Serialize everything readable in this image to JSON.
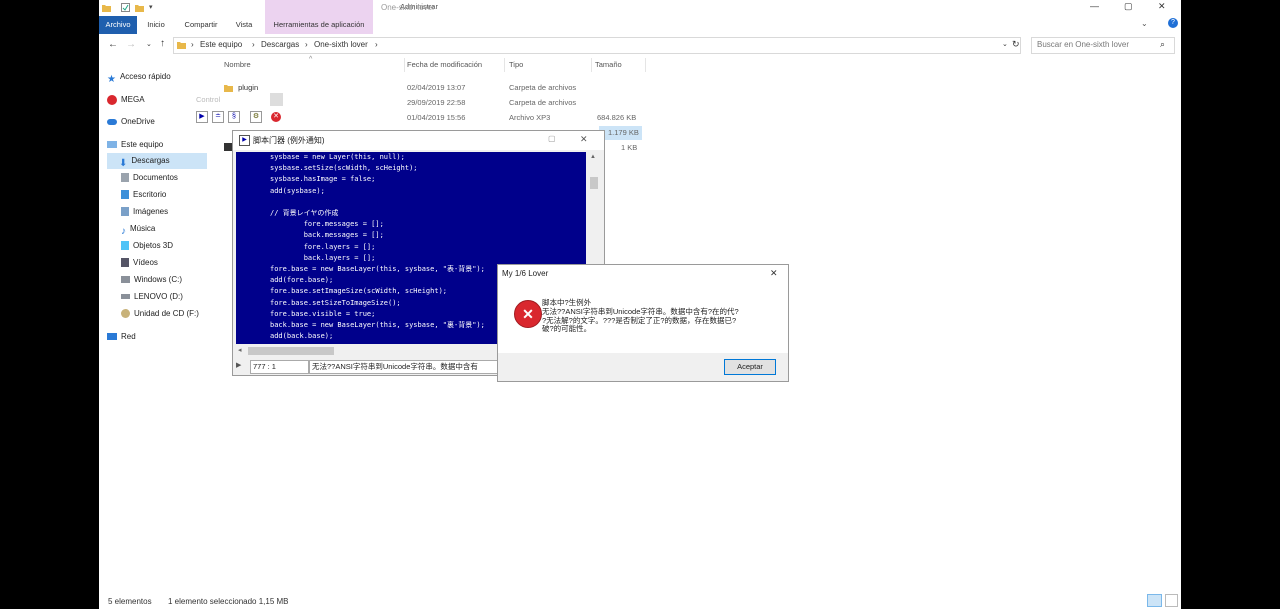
{
  "window": {
    "title": "One-sixth lover",
    "context_tab_header": "Administrar",
    "minimize": "—",
    "maximize": "▢",
    "close": "✕"
  },
  "ribbon": {
    "tabs": [
      "Archivo",
      "Inicio",
      "Compartir",
      "Vista",
      "Herramientas de aplicación"
    ]
  },
  "address": {
    "path": [
      "Este equipo",
      "Descargas",
      "One-sixth lover"
    ],
    "search_placeholder": "Buscar en One-sixth lover"
  },
  "sidebar": {
    "items": [
      {
        "label": "Acceso rápido"
      },
      {
        "label": "MEGA"
      },
      {
        "label": "OneDrive"
      },
      {
        "label": "Este equipo"
      },
      {
        "label": "Descargas"
      },
      {
        "label": "Documentos"
      },
      {
        "label": "Escritorio"
      },
      {
        "label": "Imágenes"
      },
      {
        "label": "Música"
      },
      {
        "label": "Objetos 3D"
      },
      {
        "label": "Vídeos"
      },
      {
        "label": "Windows (C:)"
      },
      {
        "label": "LENOVO (D:)"
      },
      {
        "label": "Unidad de CD (F:)"
      },
      {
        "label": "Red"
      }
    ]
  },
  "columns": {
    "name": "Nombre",
    "date": "Fecha de modificación",
    "type": "Tipo",
    "size": "Tamaño"
  },
  "files": [
    {
      "name": "plugin",
      "date": "02/04/2019 13:07",
      "type": "Carpeta de archivos",
      "size": ""
    },
    {
      "name": "",
      "date": "29/09/2019 22:58",
      "type": "Carpeta de archivos",
      "size": ""
    },
    {
      "name": "",
      "date": "01/04/2019 15:56",
      "type": "Archivo XP3",
      "size": "684.826 KB"
    },
    {
      "name": "",
      "date": "",
      "type": "",
      "size": "1.179 KB"
    },
    {
      "name": "",
      "date": "",
      "type": "",
      "size": "1 KB"
    }
  ],
  "overlay_control_label": "Control",
  "status": {
    "count": "5 elementos",
    "selection": "1 elemento seleccionado  1,15 MB"
  },
  "script_window": {
    "title": "脚本门器 (例外通知)",
    "code_lines": [
      "sysbase = new Layer(this, null);",
      "sysbase.setSize(scWidth, scHeight);",
      "sysbase.hasImage = false;",
      "add(sysbase);",
      "",
      "// 背景レイヤの作成",
      "        fore.messages = [];",
      "        back.messages = [];",
      "        fore.layers = [];",
      "        back.layers = [];",
      "fore.base = new BaseLayer(this, sysbase, \"表-背景\");",
      "add(fore.base);",
      "fore.base.setImageSize(scWidth, scHeight);",
      "fore.base.setSizeToImageSize();",
      "fore.base.visible = true;",
      "back.base = new BaseLayer(this, sysbase, \"裏-背景\");",
      "add(back.base);"
    ],
    "position": "777 : 1",
    "status_message": "无法??ANSI字符串到Unicode字符串。数据中含有"
  },
  "error_dialog": {
    "title": "My 1/6 Lover",
    "message_lines": [
      "脚本中?生例外",
      "无法??ANSI字符串到Unicode字符串。数据中含有?在的代?",
      "?无法解?的文字。???是否制定了正?的数据，存在数据已?",
      "破?的可能性。"
    ],
    "accept_label": "Aceptar",
    "close_glyph": "✕"
  },
  "colors": {
    "accent": "#1f5fae",
    "code_bg": "#00008b",
    "context_tab": "#ecd3f0",
    "selection": "#cce4f7"
  }
}
